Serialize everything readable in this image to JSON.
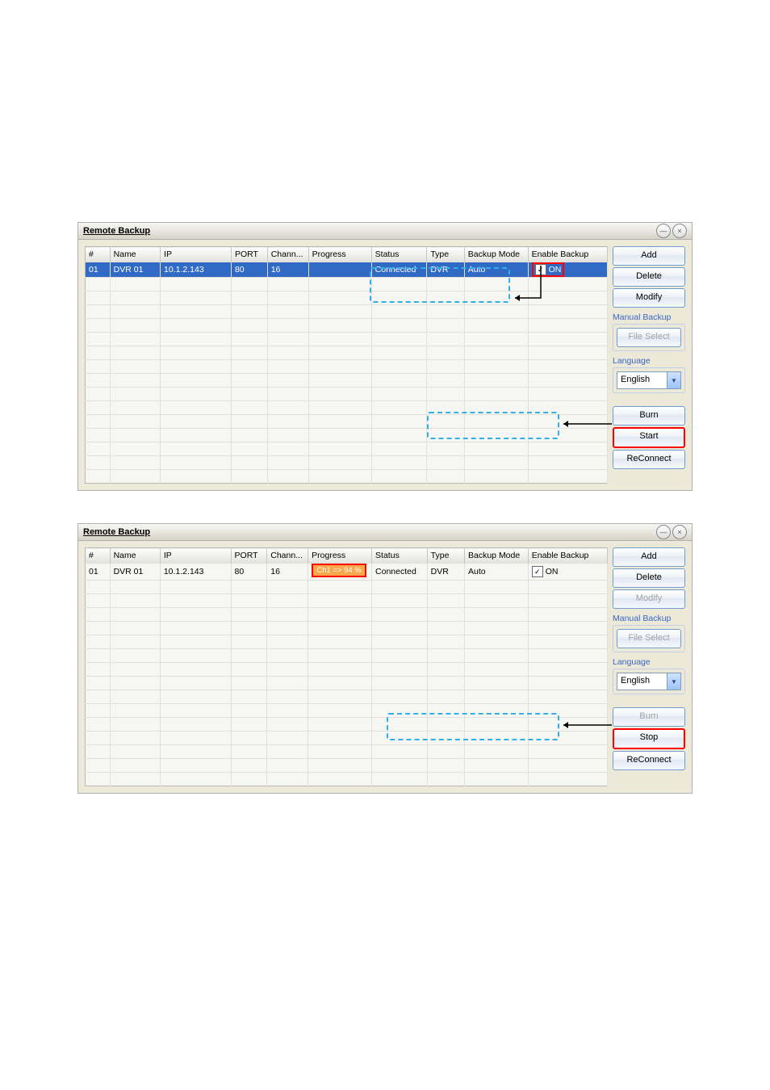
{
  "window_title": "Remote Backup",
  "columns": {
    "num": "#",
    "name": "Name",
    "ip": "IP",
    "port": "PORT",
    "chan": "Chann...",
    "prog": "Progress",
    "status": "Status",
    "type": "Type",
    "mode": "Backup Mode",
    "enable": "Enable Backup"
  },
  "row": {
    "num": "01",
    "name": "DVR 01",
    "ip": "10.1.2.143",
    "port": "80",
    "chan": "16",
    "status": "Connected",
    "type": "DVR",
    "mode": "Auto",
    "enable_label": "ON"
  },
  "progress2": "Ch1 => 94 %",
  "buttons": {
    "add": "Add",
    "delete": "Delete",
    "modify": "Modify",
    "manual_backup": "Manual Backup",
    "file_select": "File Select",
    "language": "Language",
    "burn": "Burn",
    "start": "Start",
    "stop": "Stop",
    "reconnect": "ReConnect"
  },
  "language_value": "English"
}
